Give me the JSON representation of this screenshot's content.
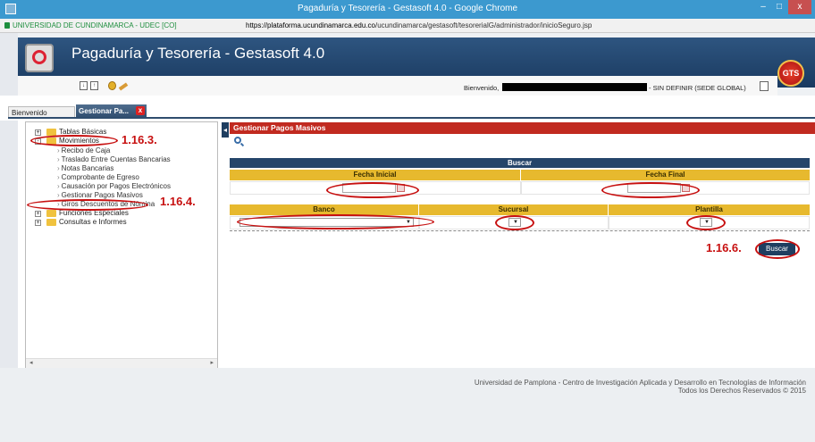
{
  "window": {
    "title": "Pagaduría y Tesorería - Gestasoft 4.0 - Google Chrome",
    "controls": {
      "minimize": "–",
      "maximize": "□",
      "close": "x"
    }
  },
  "address": {
    "site": "UNIVERSIDAD DE CUNDINAMARCA - UDEC [CO]",
    "url_host": "https://plataforma.ucundinamarca.edu.co",
    "url_path": "/ucundinamarca/gestasoft/tesorerialG/administrador/inicioSeguro.jsp"
  },
  "header": {
    "app_title": "Pagaduría y Tesorería - Gestasoft 4.0",
    "badge": "GTS",
    "welcome_prefix": "Bienvenido,",
    "welcome_suffix": "- SIN DEFINIR (SEDE GLOBAL)"
  },
  "tabs": [
    {
      "label": "Bienvenido"
    },
    {
      "label": "Gestionar Pa...",
      "close": "x"
    }
  ],
  "tree": {
    "items": [
      {
        "label": "Tablas Básicas",
        "expander": "+"
      },
      {
        "label": "Movimientos",
        "expander": "-"
      },
      {
        "label": "Funciones Especiales",
        "expander": "+"
      },
      {
        "label": "Consultas e Informes",
        "expander": "+"
      }
    ],
    "children": [
      "Recibo de Caja",
      "Traslado Entre Cuentas Bancarias",
      "Notas Bancarias",
      "Comprobante de Egreso",
      "Causación por Pagos Electrónicos",
      "Gestionar Pagos Masivos",
      "Giros Descuentos de Nómina"
    ],
    "scroll_left": "◂",
    "scroll_right": "▸"
  },
  "main": {
    "title": "Gestionar Pagos Masivos",
    "collapse": "◂",
    "section": "Buscar",
    "fields": {
      "fecha_inicial": "Fecha Inicial",
      "fecha_final": "Fecha Final",
      "banco": "Banco",
      "sucursal": "Sucursal",
      "plantilla": "Plantilla"
    },
    "dropdown_arrow": "▼",
    "search_button": "Buscar"
  },
  "annotations": {
    "a1": "1.16.3.",
    "a2": "1.16.4.",
    "a3": "1.16.6."
  },
  "footer": {
    "line1": "Universidad de Pamplona - Centro de Investigación Aplicada y Desarrollo en Tecnologías de Información",
    "line2": "Todos los Derechos Reservados © 2015"
  },
  "colors": {
    "titlebar": "#3c99cf",
    "banner": "#2e5580",
    "panel_header": "#c12a20",
    "section_bar": "#25456a",
    "field_header": "#e7b92e",
    "annotation": "#c71010"
  }
}
